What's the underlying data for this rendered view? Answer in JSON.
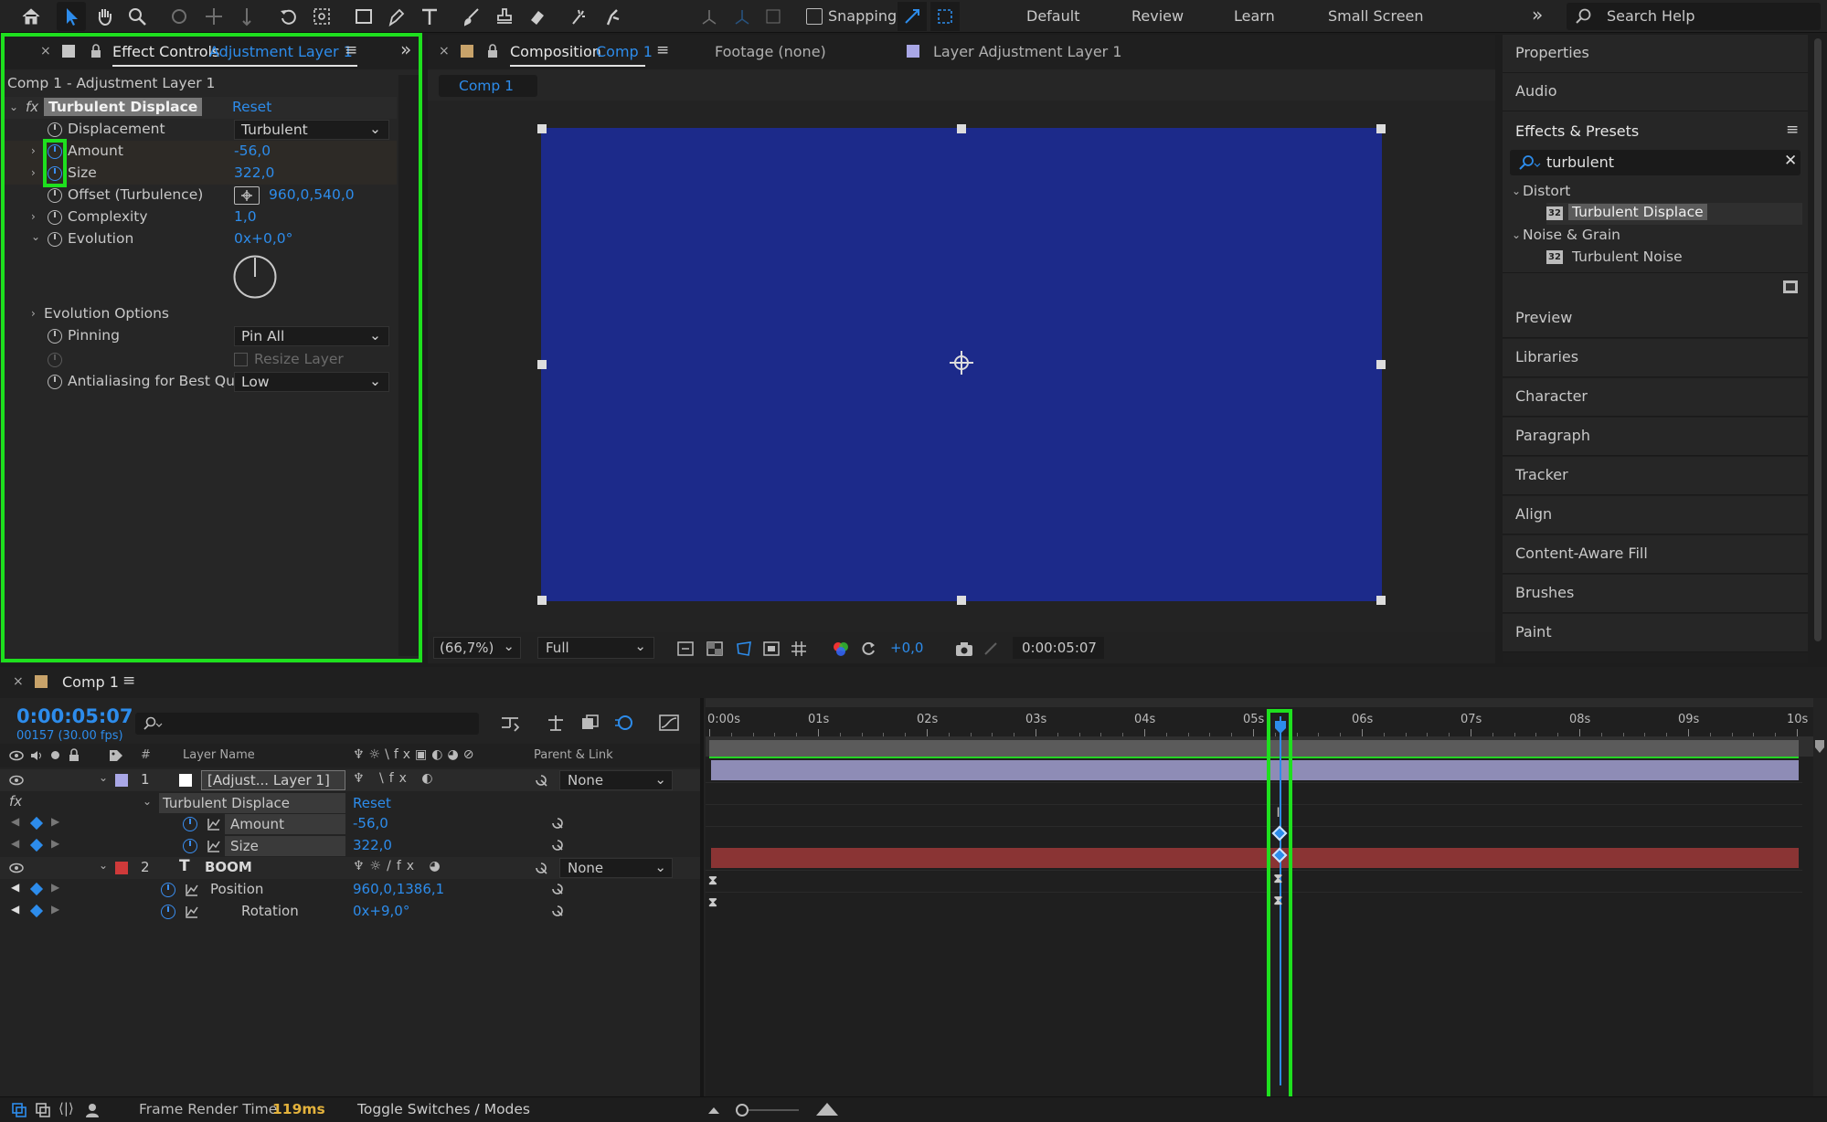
{
  "toolbar": {
    "snapping_label": "Snapping",
    "workspaces": [
      "Default",
      "Review",
      "Learn",
      "Small Screen"
    ],
    "search_placeholder": "Search Help"
  },
  "effect_controls": {
    "tab_prefix": "Effect Controls",
    "tab_layer": "Adjustment Layer 1",
    "breadcrumb": "Comp 1 - Adjustment Layer 1",
    "effect_name": "Turbulent Displace",
    "reset_label": "Reset",
    "props": [
      {
        "label": "Displacement",
        "value": "Turbulent"
      },
      {
        "label": "Amount",
        "value": "-56,0"
      },
      {
        "label": "Size",
        "value": "322,0"
      },
      {
        "label": "Offset (Turbulence)",
        "value": "960,0,540,0"
      },
      {
        "label": "Complexity",
        "value": "1,0"
      },
      {
        "label": "Evolution",
        "value": "0x+0,0°"
      },
      {
        "label": "Evolution Options",
        "value": ""
      },
      {
        "label": "Pinning",
        "value": "Pin All"
      },
      {
        "label": "Resize Layer",
        "value": ""
      },
      {
        "label": "Antialiasing for Best Qua",
        "value": "Low"
      }
    ]
  },
  "composition": {
    "tab_prefix": "Composition",
    "tab_comp": "Comp 1",
    "footage_tab": "Footage (none)",
    "layer_tab": "Layer Adjustment Layer 1",
    "subtab": "Comp 1",
    "zoom": "(66,7%)",
    "resolution": "Full",
    "exposure": "+0,0",
    "timecode": "0:00:05:07",
    "bg_color": "#1c2a8a"
  },
  "right_panel": {
    "properties": "Properties",
    "audio": "Audio",
    "effects_presets": "Effects & Presets",
    "search_value": "turbulent",
    "groups": [
      {
        "name": "Distort",
        "item": "Turbulent Displace",
        "badge": "32"
      },
      {
        "name": "Noise & Grain",
        "item": "Turbulent Noise",
        "badge": "32"
      }
    ],
    "panels": [
      "Preview",
      "Libraries",
      "Character",
      "Paragraph",
      "Tracker",
      "Align",
      "Content-Aware Fill",
      "Brushes",
      "Paint"
    ]
  },
  "timeline": {
    "tab": "Comp 1",
    "timecode": "0:00:05:07",
    "frame_info": "00157 (30.00 fps)",
    "col_layer_name": "Layer Name",
    "col_parent": "Parent & Link",
    "col_num": "#",
    "ruler": [
      "0:00s",
      "01s",
      "02s",
      "03s",
      "04s",
      "05s",
      "06s",
      "07s",
      "08s",
      "09s",
      "10s"
    ],
    "layers": [
      {
        "num": "1",
        "name": "[Adjust... Layer 1]",
        "parent": "None",
        "color": "#a9a7e6"
      },
      {
        "num": "2",
        "name": "BOOM",
        "parent": "None",
        "color": "#cf3a3a"
      }
    ],
    "effect": {
      "name": "Turbulent Displace",
      "reset": "Reset"
    },
    "effect_props": [
      {
        "label": "Amount",
        "value": "-56,0"
      },
      {
        "label": "Size",
        "value": "322,0"
      }
    ],
    "layer2_props": [
      {
        "label": "Position",
        "value": "960,0,1386,1"
      },
      {
        "label": "Rotation",
        "value": "0x+9,0°"
      }
    ],
    "playhead_fraction": 0.524
  },
  "status": {
    "frame_render_label": "Frame Render Time",
    "frame_render_value": "119ms",
    "toggle_label": "Toggle Switches / Modes"
  }
}
